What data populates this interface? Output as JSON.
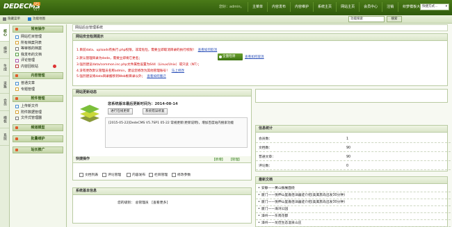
{
  "header": {
    "logo": "DEDECMS",
    "logo_version": "V5.7",
    "logo_badge": "SP1",
    "user_info": "您好：admin，",
    "nav": [
      "主菜单",
      "内容发布",
      "内容维护",
      "系统主页",
      "网站主页",
      "会员中心",
      "注销",
      "织梦模板大全"
    ],
    "quick_select": "快捷方式..."
  },
  "toolbar": {
    "hide_menu": "隐藏菜单",
    "function_map": "功能地图",
    "search_value": "功能搜索",
    "search_btn": "搜索"
  },
  "vtabs": [
    "核心",
    "模块",
    "生成",
    "采集",
    "会员",
    "模板",
    "系统"
  ],
  "sidebar": {
    "groups": [
      {
        "title": "常用操作",
        "items": [
          "网站栏目管理",
          "所有档案列表",
          "等审核的档案",
          "我发布的文档",
          "评论管理",
          "内容回收站"
        ]
      },
      {
        "title": "内容管理",
        "items": [
          "普通文章",
          "专题管理"
        ]
      },
      {
        "title": "附件管理",
        "items": [
          "上传新文件",
          "附件数据管理",
          "文件式管理器"
        ]
      },
      {
        "title": "频道模型",
        "items": []
      },
      {
        "title": "批量维护",
        "items": []
      },
      {
        "title": "站长推广",
        "items": []
      }
    ]
  },
  "main": {
    "breadcrumb": "网站后台管理系统",
    "security": {
      "title": "网站安全检测提示",
      "lines": [
        {
          "text": "1.目前data、uploads有执行.php权限，非常危险，需要立即取消目录的执行权限！",
          "link": "查看如何取消"
        },
        {
          "text": "2.默认管理目录为dede，需要立即将它更名；",
          "link": ""
        },
        {
          "text": "3.强烈建议data/common.inc.php文件属性设置为644（Linux/Unix）或只读（NT）；",
          "link": ""
        },
        {
          "text": "4.没有更改默认管理员名称admin，建议您修改为其他管理账号！",
          "link": "马上修改"
        },
        {
          "text": "5.强烈建议将data目录搬移到Web根目录以外；",
          "link": "查看如何搬迁"
        }
      ],
      "check_btn": "全面检测",
      "check_link": "查看如何取消"
    },
    "update": {
      "title": "网站更新动态",
      "heading": "您系统版本最后更新时间为：2014-08-14",
      "btn_check": "进行在线更新",
      "btn_quick": "系统错误修复",
      "log": "[2015-05-22]DedeCMS V5.7SP1 05-22 常规更新(更新说明)，增加百度站内搜索功能"
    },
    "quick_ops": {
      "title": "快捷操作",
      "new": "【新增】",
      "manage": "【管理】",
      "items": [
        "文档列表",
        "评论管理",
        "内容发布",
        "栏目管理",
        "修改参数"
      ]
    },
    "sysinfo": {
      "title": "系统基本信息",
      "label": "您的级别：",
      "value": "总管理员",
      "link": "[查看更多]"
    },
    "stats": {
      "title": "信息统计",
      "rows": [
        {
          "label": "会员数：",
          "value": "1"
        },
        {
          "label": "文档数：",
          "value": "90"
        },
        {
          "label": "普通文章：",
          "value": "90"
        },
        {
          "label": "评论数：",
          "value": "0"
        }
      ]
    },
    "news": {
      "title": "最新文档",
      "items": [
        "安静——黄山振展面绕",
        "厦门——悦伸山里嘉佰详器迹介绍(奥美旅岛出发30分钟)",
        "厦门——悦伸山里嘉佰详器迹介绍(奥美旅岛出发30分钟)",
        "厦门——海湾公园",
        "漳州——东南花都",
        "漳州——龙佳生态温泉山庄"
      ]
    }
  },
  "colors": {
    "brand": "#3d6a12",
    "warn": "#cc0000",
    "link": "#2a4fb8"
  }
}
